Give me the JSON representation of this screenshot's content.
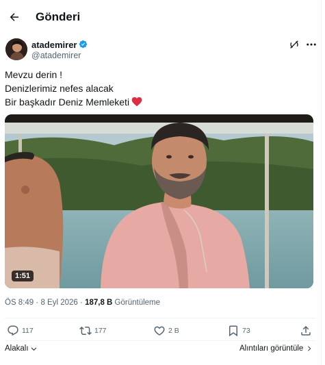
{
  "header": {
    "title": "Gönderi",
    "back_icon": "arrow-left-icon"
  },
  "author": {
    "display_name": "atademirer",
    "handle": "@atademirer",
    "verified": true,
    "verified_color": "#1d9bf0"
  },
  "tweet": {
    "lines": [
      "Mevzu derin !",
      "Denizlerimiz nefes alacak",
      "Bir başkadır Deniz Memleketi"
    ],
    "emoji": "red-heart",
    "emoji_color": "#e0245e"
  },
  "media": {
    "type": "video",
    "duration": "1:51"
  },
  "meta": {
    "time": "ÖS 8:49",
    "separator": "·",
    "date": "8 Eyl 2026",
    "views_count": "187,8 B",
    "views_label": "Görüntüleme"
  },
  "actions": {
    "replies": "117",
    "reposts": "177",
    "likes": "2 B",
    "bookmarks": "73"
  },
  "footer": {
    "left_label": "Alakalı",
    "right_label": "Alıntıları görüntüle"
  },
  "colors": {
    "text": "#0f1419",
    "secondary": "#536471",
    "divider": "#eff3f4",
    "accent": "#1d9bf0"
  }
}
